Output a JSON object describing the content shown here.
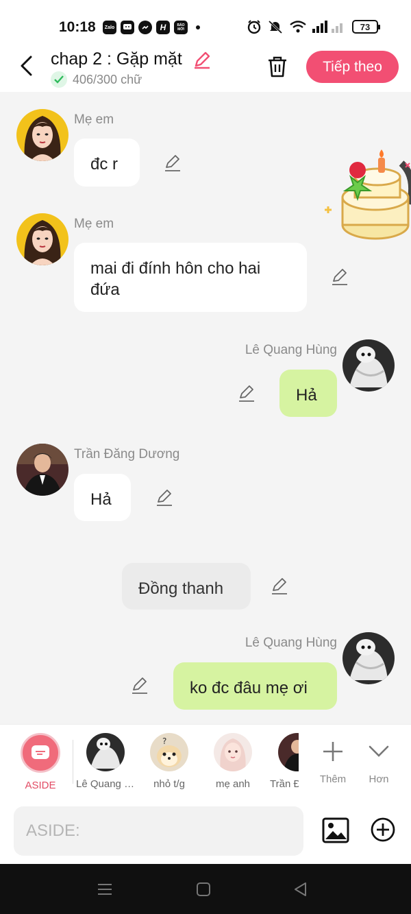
{
  "status_bar": {
    "time": "10:18",
    "apps": [
      "Zalo",
      "chat",
      "messenger",
      "H",
      "BÁO MỚI"
    ],
    "battery": "73"
  },
  "header": {
    "title": "chap 2 : Gặp mặt",
    "word_count": "406/300 chữ",
    "next_label": "Tiếp theo",
    "accent": "#f24f73"
  },
  "messages": [
    {
      "sender": "Mẹ em",
      "text": "đc r",
      "side": "left"
    },
    {
      "sender": "Mẹ em",
      "text": "mai đi đính hôn cho hai đứa",
      "side": "left"
    },
    {
      "sender": "Lê Quang Hùng",
      "text": "Hả",
      "side": "right"
    },
    {
      "sender": "Trần Đăng Dương",
      "text": "Hả",
      "side": "left"
    },
    {
      "sender": "",
      "text": "Đồng thanh",
      "side": "center"
    },
    {
      "sender": "Lê Quang Hùng",
      "text": "ko đc đâu mẹ ơi",
      "side": "right"
    }
  ],
  "characters": {
    "aside_label": "ASIDE",
    "items": [
      "Lê Quang Hùng",
      "nhỏ t/g",
      "mẹ anh",
      "Trần Đăng Dương"
    ],
    "add_label": "Thêm",
    "more_label": "Hơn"
  },
  "input": {
    "placeholder": "ASIDE:"
  },
  "colors": {
    "right_bubble": "#d6f3a1",
    "left_bubble": "#ffffff",
    "aside": "#f06b7b"
  }
}
